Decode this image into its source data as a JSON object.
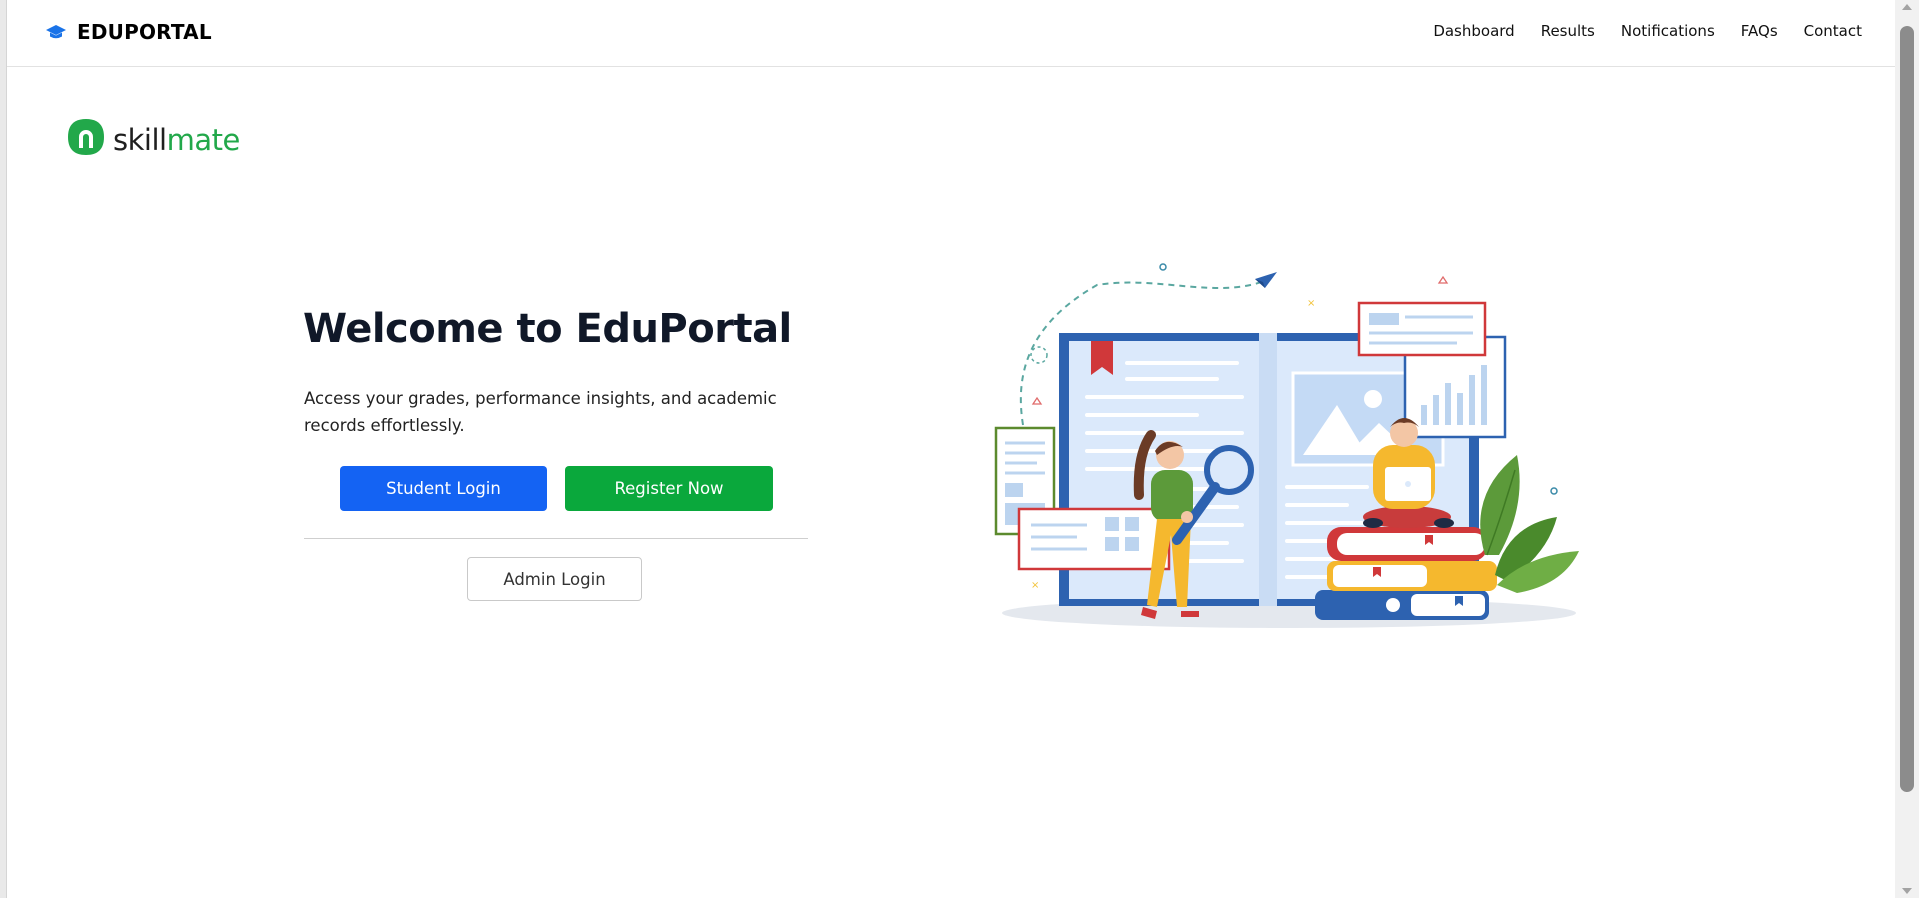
{
  "navbar": {
    "brand": "EDUPORTAL",
    "brand_icon": "graduation-cap-icon",
    "links": [
      "Dashboard",
      "Results",
      "Notifications",
      "FAQs",
      "Contact"
    ]
  },
  "logo": {
    "word_part1": "skill",
    "word_part2": "mate",
    "icon": "skillmate-logo-icon"
  },
  "hero": {
    "title": "Welcome to EduPortal",
    "description": "Access your grades, performance insights, and academic records effortlessly.",
    "student_login": "Student Login",
    "register_now": "Register Now",
    "admin_login": "Admin Login"
  },
  "colors": {
    "primary_blue": "#1463f3",
    "primary_green": "#0aa83c",
    "logo_green": "#22a84a",
    "brand_icon_blue": "#1a73e8"
  }
}
